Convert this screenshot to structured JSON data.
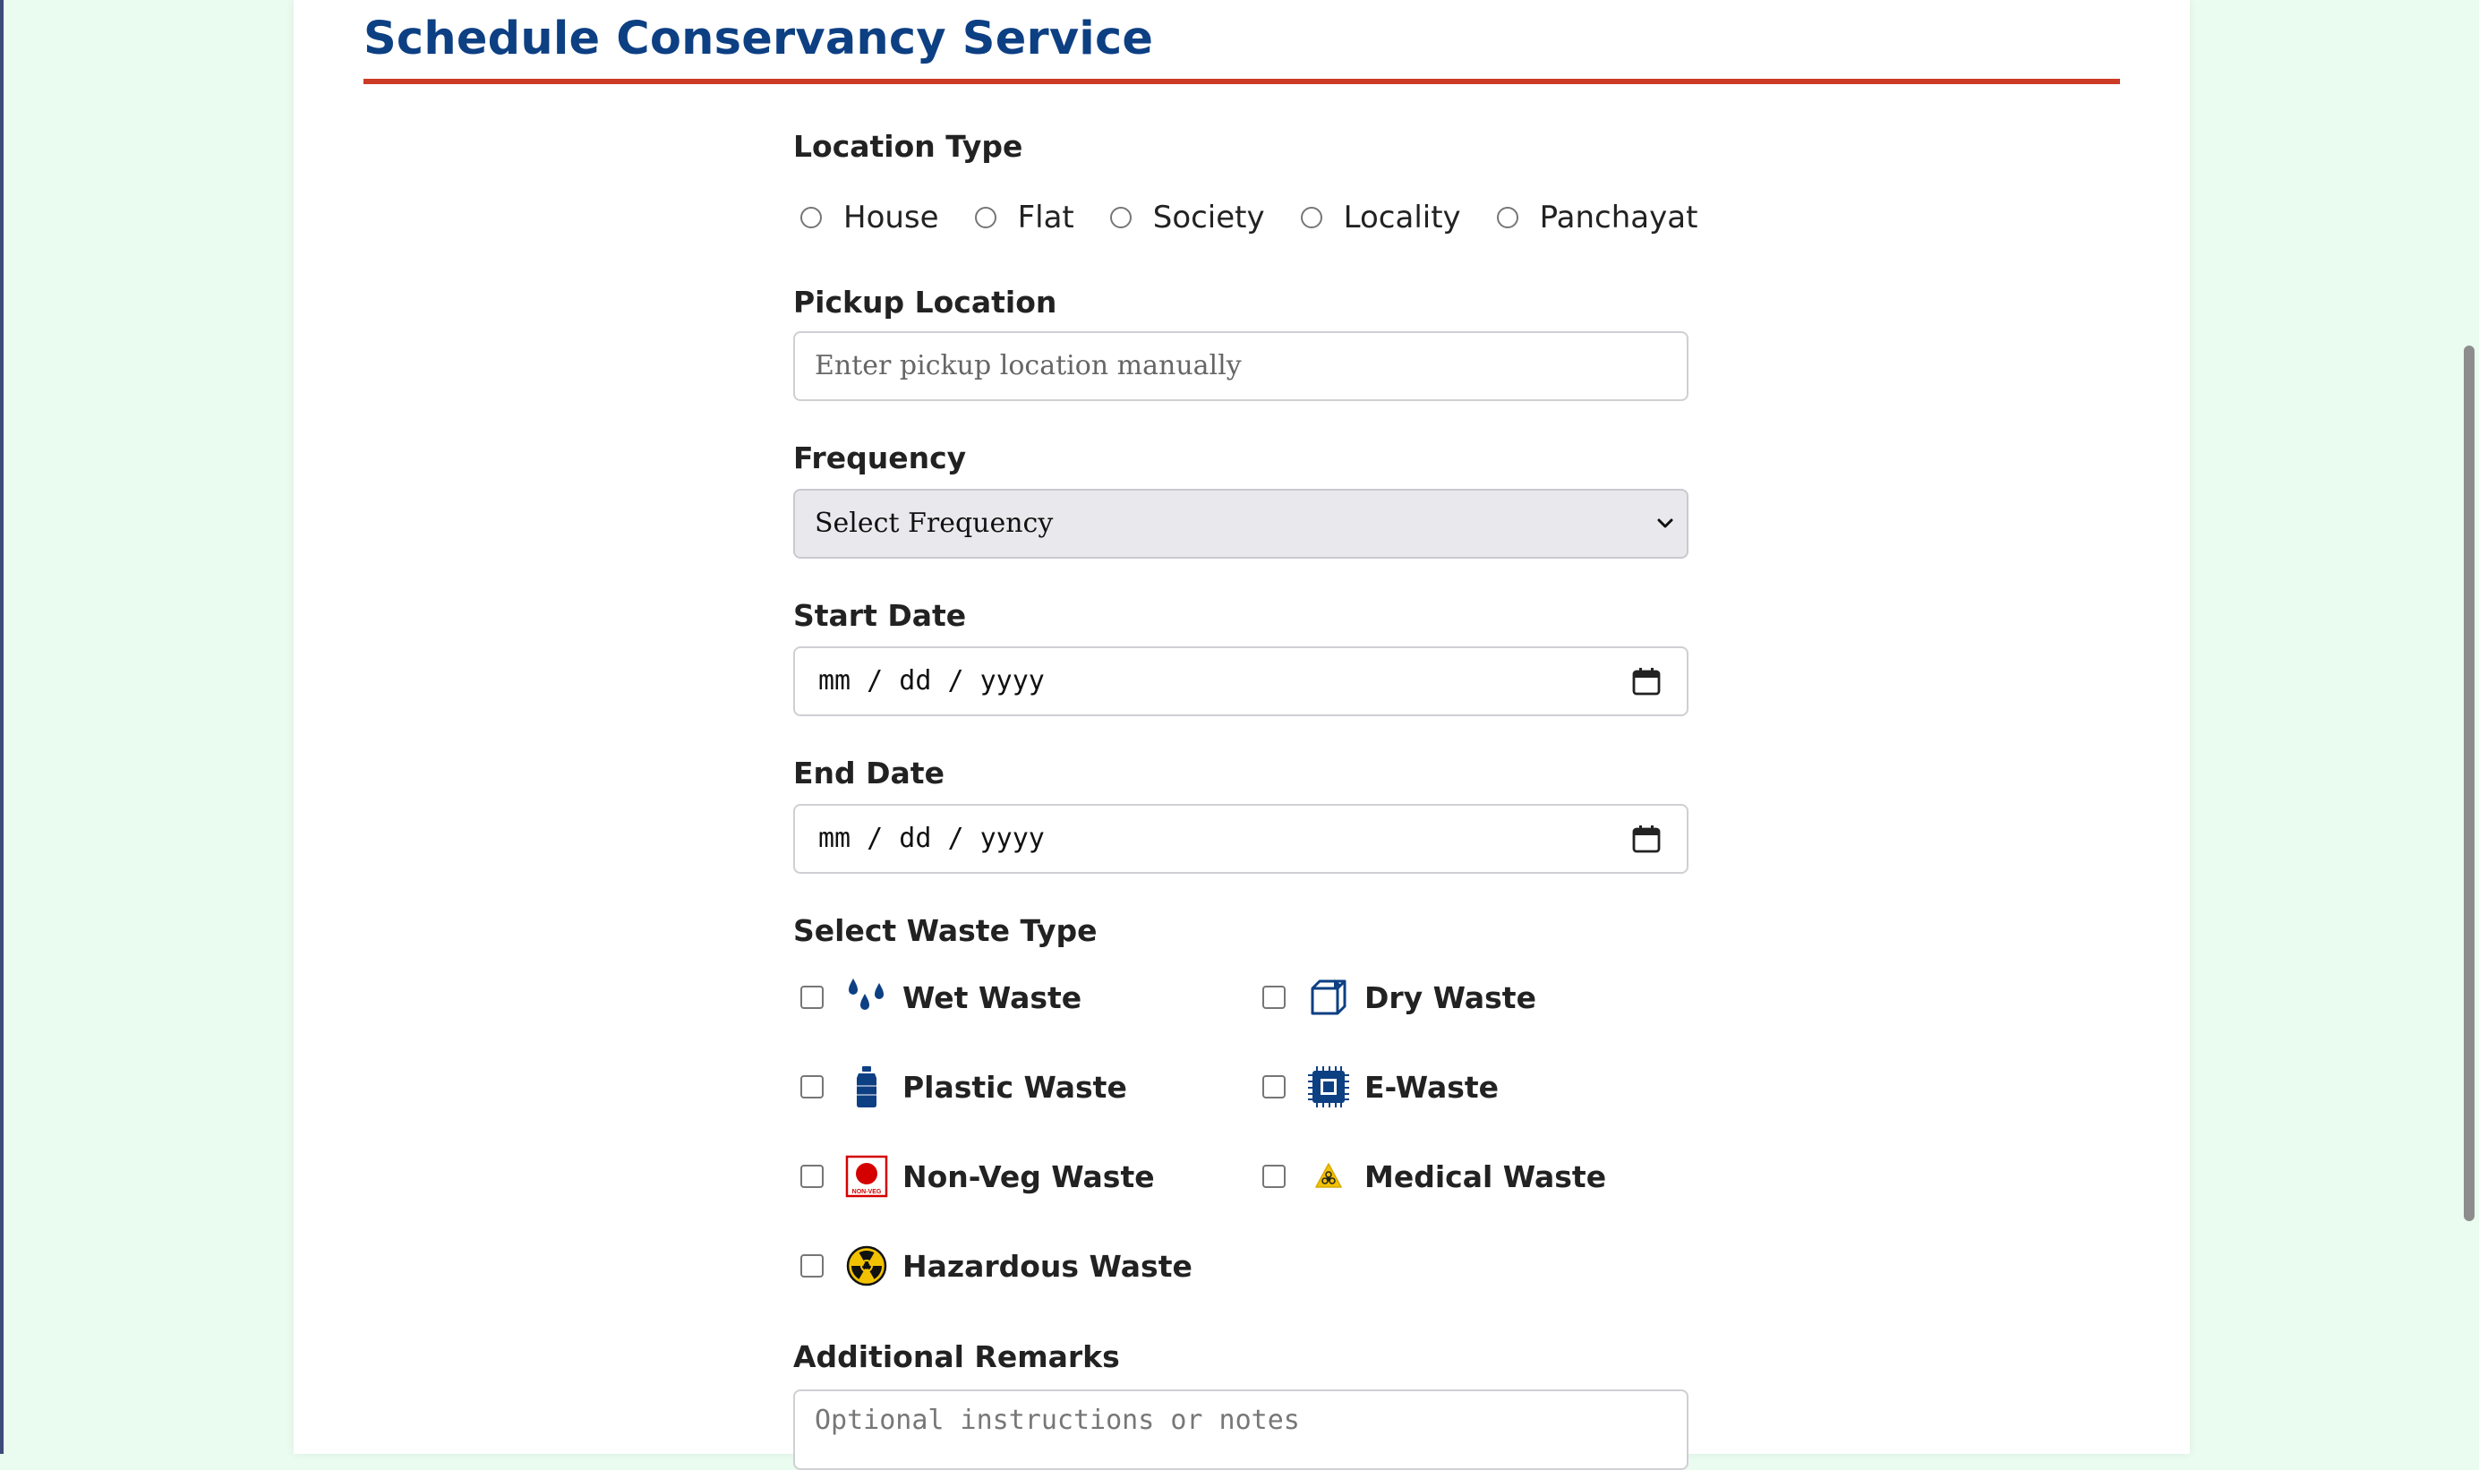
{
  "page": {
    "title": "Schedule Conservancy Service"
  },
  "form": {
    "location_type": {
      "label": "Location Type",
      "options": [
        "House",
        "Flat",
        "Society",
        "Locality",
        "Panchayat"
      ]
    },
    "pickup_location": {
      "label": "Pickup Location",
      "placeholder": "Enter pickup location manually"
    },
    "frequency": {
      "label": "Frequency",
      "selected": "Select Frequency"
    },
    "start_date": {
      "label": "Start Date",
      "placeholder": "mm / dd / yyyy"
    },
    "end_date": {
      "label": "End Date",
      "placeholder": "mm / dd / yyyy"
    },
    "waste_type": {
      "label": "Select Waste Type",
      "items": [
        {
          "label": "Wet Waste",
          "icon": "water-drops-icon"
        },
        {
          "label": "Dry Waste",
          "icon": "box-icon"
        },
        {
          "label": "Plastic Waste",
          "icon": "bottle-icon"
        },
        {
          "label": "E-Waste",
          "icon": "chip-icon"
        },
        {
          "label": "Non-Veg Waste",
          "icon": "non-veg-icon",
          "icon_text": "NON-VEG"
        },
        {
          "label": "Medical Waste",
          "icon": "biohazard-icon"
        },
        {
          "label": "Hazardous Waste",
          "icon": "radiation-icon"
        }
      ]
    },
    "remarks": {
      "label": "Additional Remarks",
      "placeholder": "Optional instructions or notes"
    }
  },
  "colors": {
    "background": "#eafbf0",
    "title": "#0d3f83",
    "accent_rule": "#cc3b26",
    "icon_blue": "#0d3f83",
    "non_veg_red": "#d40000",
    "hazard_yellow": "#f2c200"
  }
}
